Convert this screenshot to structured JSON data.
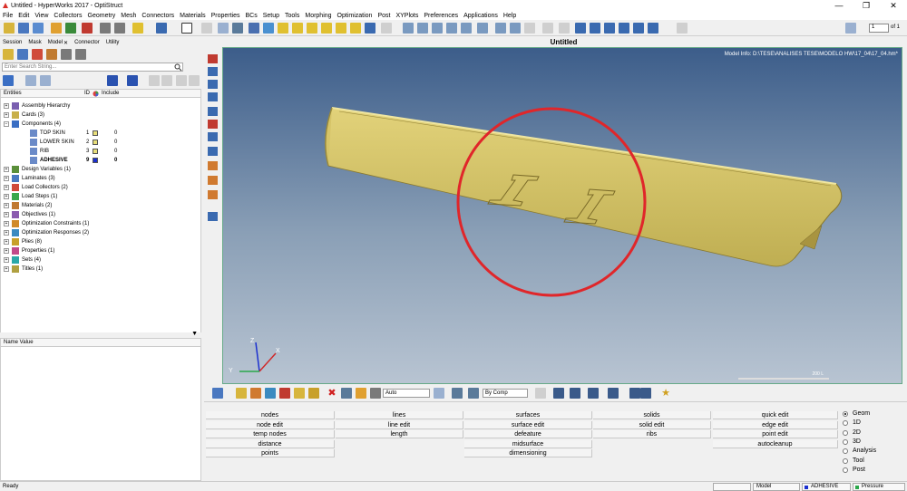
{
  "window": {
    "title": "Untitled - HyperWorks 2017 - OptiStruct",
    "controls": [
      "—",
      "❐",
      "✕"
    ]
  },
  "menu": [
    "File",
    "Edit",
    "View",
    "Collectors",
    "Geometry",
    "Mesh",
    "Connectors",
    "Materials",
    "Properties",
    "BCs",
    "Setup",
    "Tools",
    "Morphing",
    "Optimization",
    "Post",
    "XYPlots",
    "Preferences",
    "Applications",
    "Help"
  ],
  "toolbar": {
    "page_value": "1",
    "page_of": "of 1"
  },
  "browser": {
    "tabs": [
      "Session",
      "Mask",
      "Model",
      "Connector",
      "Utility"
    ],
    "search_placeholder": "Enter Search String...",
    "header": {
      "entities": "Entities",
      "id": "ID",
      "include": "Include"
    },
    "tree": [
      {
        "label": "Assembly Hierarchy",
        "icon_color": "#7a5fb0"
      },
      {
        "label": "Cards (3)",
        "icon_color": "#c8b04a"
      },
      {
        "label": "Components (4)",
        "icon_color": "#3b6fc4",
        "expanded": true
      },
      {
        "label": "TOP SKIN",
        "id": "1",
        "include": "0",
        "swatch": "#e8de7a",
        "child": true
      },
      {
        "label": "LOWER SKIN",
        "id": "2",
        "include": "0",
        "swatch": "#e8de7a",
        "child": true
      },
      {
        "label": "RIB",
        "id": "3",
        "include": "0",
        "swatch": "#e8de7a",
        "child": true
      },
      {
        "label": "ADHESIVE",
        "id": "9",
        "include": "0",
        "swatch": "#1a2fd0",
        "child": true,
        "bold": true
      },
      {
        "label": "Design Variables (1)",
        "icon_color": "#5a8f3a"
      },
      {
        "label": "Laminates (3)",
        "icon_color": "#4a7ac0"
      },
      {
        "label": "Load Collectors (2)",
        "icon_color": "#d04a3a"
      },
      {
        "label": "Load Steps (1)",
        "icon_color": "#3aa84a"
      },
      {
        "label": "Materials (2)",
        "icon_color": "#c07a30"
      },
      {
        "label": "Objectives (1)",
        "icon_color": "#8a5ab0"
      },
      {
        "label": "Optimization Constraints (1)",
        "icon_color": "#d08a2a"
      },
      {
        "label": "Optimization Responses (2)",
        "icon_color": "#3a8ac0"
      },
      {
        "label": "Plies (8)",
        "icon_color": "#c8a02a"
      },
      {
        "label": "Properties (1)",
        "icon_color": "#c04a8a"
      },
      {
        "label": "Sets (4)",
        "icon_color": "#2aa8a8"
      },
      {
        "label": "Titles (1)",
        "icon_color": "#b0a040"
      }
    ],
    "name_value_header": "Name Value"
  },
  "viewport": {
    "title": "Untitled",
    "model_info": "Model Info: D:\\TESE\\ANALISES TESE\\MODELO HW\\17_04\\17_04.hm*",
    "scale_label": "200 L",
    "triad": {
      "x": "X",
      "y": "Y",
      "z": "Z"
    }
  },
  "bottom_toolbar": {
    "display_mode": "Auto",
    "color_mode": "By Comp"
  },
  "panel": {
    "col1": [
      "nodes",
      "node edit",
      "temp nodes",
      "distance",
      "points"
    ],
    "col2": [
      "lines",
      "line edit",
      "length"
    ],
    "col3": [
      "surfaces",
      "surface edit",
      "defeature",
      "midsurface",
      "dimensioning"
    ],
    "col4": [
      "solids",
      "solid edit",
      "ribs"
    ],
    "col5": [
      "quick edit",
      "edge edit",
      "point edit",
      "autocleanup"
    ],
    "radios": [
      "Geom",
      "1D",
      "2D",
      "3D",
      "Analysis",
      "Tool",
      "Post"
    ],
    "selected_radio": "Geom"
  },
  "status": {
    "left": "Ready",
    "model": "Model",
    "component": "ADHESIVE",
    "loadcol": "Pressure"
  }
}
